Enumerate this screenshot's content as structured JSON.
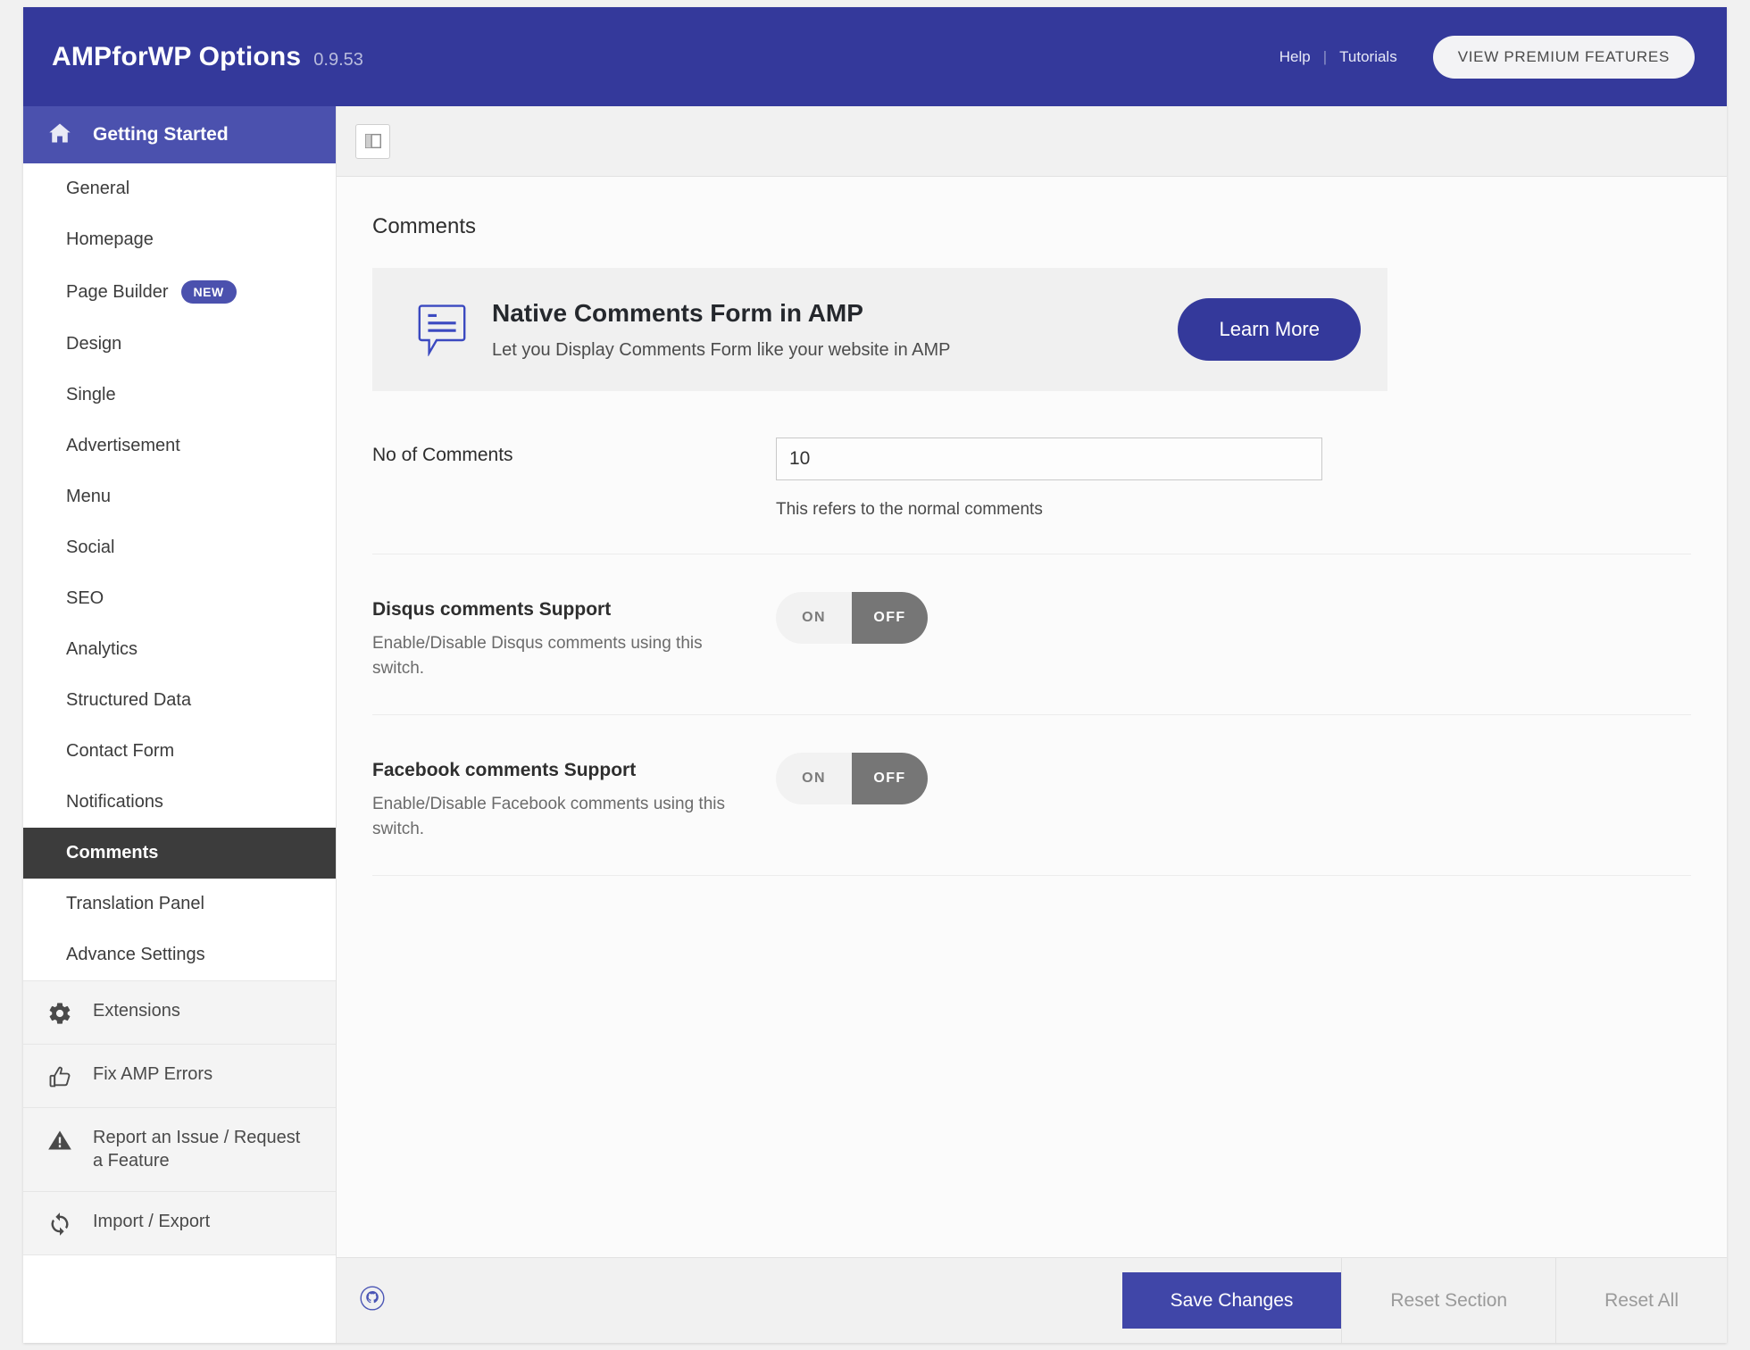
{
  "header": {
    "title": "AMPforWP Options",
    "version": "0.9.53",
    "links": [
      {
        "label": "Help",
        "name": "help-link"
      },
      {
        "label": "Tutorials",
        "name": "tutorials-link"
      }
    ],
    "separator": "|",
    "premium_button": "VIEW PREMIUM FEATURES",
    "bg_color": "#34399b"
  },
  "sidebar": {
    "nav_header": {
      "label": "Getting Started",
      "icon": "home-icon",
      "bg_color": "#4b51ae"
    },
    "items": [
      {
        "label": "General",
        "active": false
      },
      {
        "label": "Homepage",
        "active": false
      },
      {
        "label": "Page Builder",
        "active": false,
        "badge": "NEW"
      },
      {
        "label": "Design",
        "active": false
      },
      {
        "label": "Single",
        "active": false
      },
      {
        "label": "Advertisement",
        "active": false
      },
      {
        "label": "Menu",
        "active": false
      },
      {
        "label": "Social",
        "active": false
      },
      {
        "label": "SEO",
        "active": false
      },
      {
        "label": "Analytics",
        "active": false
      },
      {
        "label": "Structured Data",
        "active": false
      },
      {
        "label": "Contact Form",
        "active": false
      },
      {
        "label": "Notifications",
        "active": false
      },
      {
        "label": "Comments",
        "active": true
      },
      {
        "label": "Translation Panel",
        "active": false
      },
      {
        "label": "Advance Settings",
        "active": false
      }
    ],
    "tool_items": [
      {
        "label": "Extensions",
        "icon": "gear-icon"
      },
      {
        "label": "Fix AMP Errors",
        "icon": "thumbs-up-icon"
      },
      {
        "label": "Report an Issue / Request a Feature",
        "icon": "warning-icon"
      },
      {
        "label": "Import / Export",
        "icon": "sync-icon"
      }
    ],
    "active_bg_color": "#3c3c3c"
  },
  "toolbar": {
    "layout_toggle_icon": "layout-panel-icon"
  },
  "main": {
    "section_title": "Comments",
    "promo": {
      "icon": "comment-bubble-icon",
      "title": "Native Comments Form in AMP",
      "subtitle": "Let you Display Comments Form like your website in AMP",
      "button_label": "Learn More",
      "button_color": "#34399b"
    },
    "fields": [
      {
        "type": "text",
        "label": "No of Comments",
        "value": "10",
        "placeholder": "",
        "hint": "This refers to the normal comments"
      },
      {
        "type": "toggle",
        "label": "Disqus comments Support",
        "description": "Enable/Disable Disqus comments using this switch.",
        "on_label": "ON",
        "off_label": "OFF",
        "state": "OFF"
      },
      {
        "type": "toggle",
        "label": "Facebook comments Support",
        "description": "Enable/Disable Facebook comments using this switch.",
        "on_label": "ON",
        "off_label": "OFF",
        "state": "OFF"
      }
    ]
  },
  "footer": {
    "logo_icon": "github-octocat-icon",
    "save_label": "Save Changes",
    "reset_section_label": "Reset Section",
    "reset_all_label": "Reset All",
    "save_color": "#4046a8"
  }
}
